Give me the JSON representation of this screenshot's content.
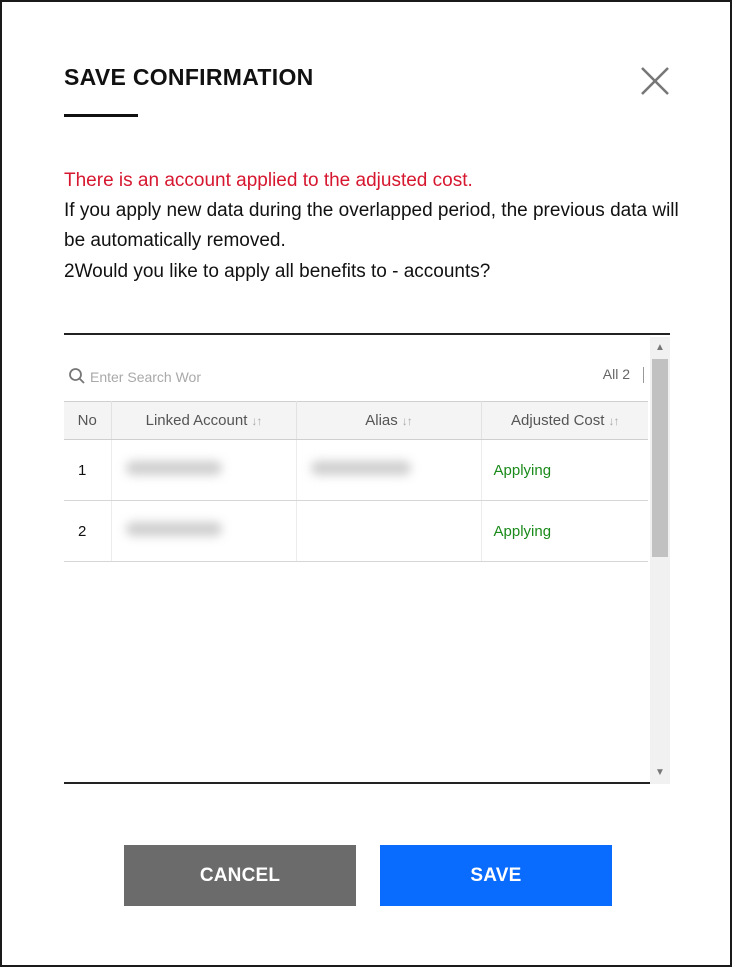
{
  "dialog": {
    "title": "SAVE CONFIRMATION",
    "close_icon": "close-icon",
    "warning_text": "There is an account applied to the adjusted cost.",
    "message_line1": "If you apply new data during the overlapped period, the previous data will be automatically removed.",
    "message_line2": "2Would you like to apply all benefits to - accounts?",
    "warning_color": "#d6172f"
  },
  "search": {
    "placeholder": "Enter Search Wor",
    "icon": "search-icon"
  },
  "table": {
    "count_label": "All 2",
    "columns": [
      {
        "label": "No",
        "sortable": false
      },
      {
        "label": "Linked Account",
        "sortable": true
      },
      {
        "label": "Alias",
        "sortable": true
      },
      {
        "label": "Adjusted Cost",
        "sortable": true
      }
    ],
    "sort_glyph": "↓↑",
    "rows": [
      {
        "no": "1",
        "status": "Applying"
      },
      {
        "no": "2",
        "status": "Applying"
      }
    ],
    "status_color": "#1a8a1a"
  },
  "buttons": {
    "cancel_label": "CANCEL",
    "save_label": "SAVE",
    "cancel_color": "#6b6b6b",
    "save_color": "#0a6cff"
  }
}
